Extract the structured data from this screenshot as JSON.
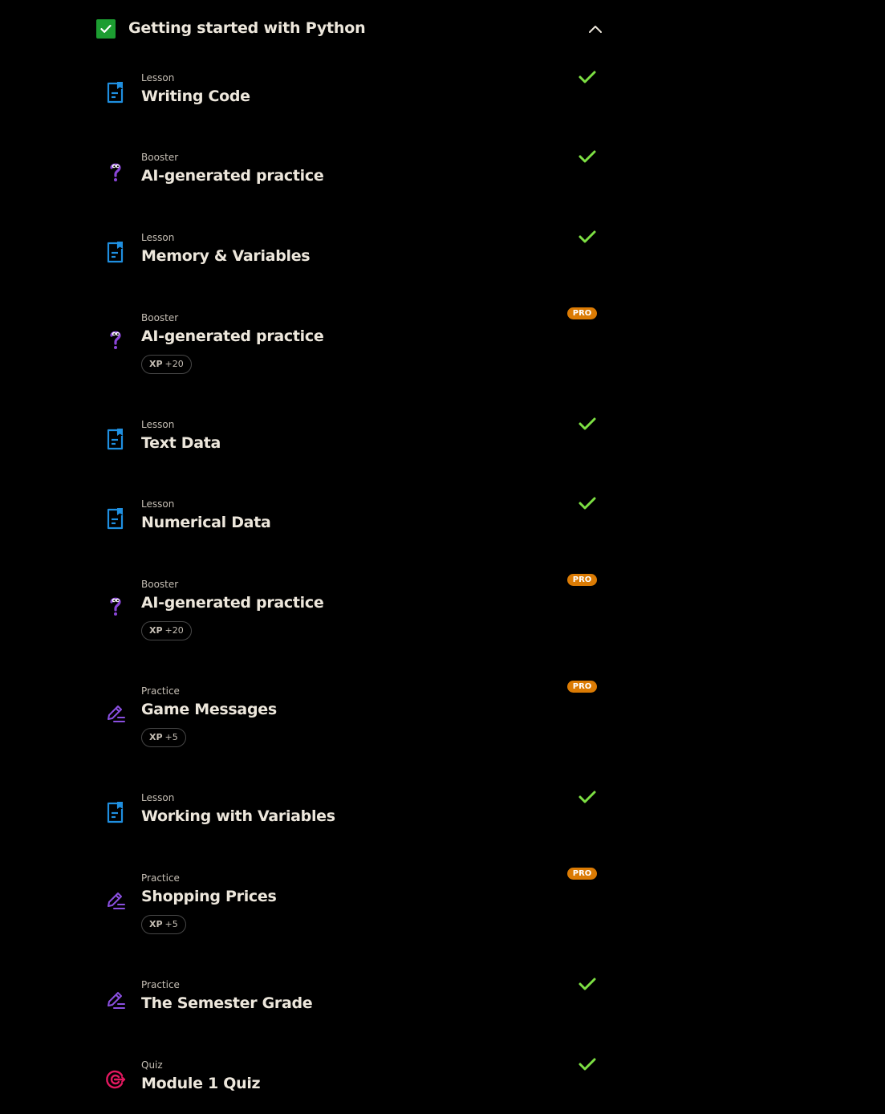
{
  "module": {
    "title": "Getting started with Python",
    "completed": true
  },
  "items": [
    {
      "type": "Lesson",
      "title": "Writing Code",
      "icon": "lesson-icon",
      "status": "completed"
    },
    {
      "type": "Booster",
      "title": "AI-generated practice",
      "icon": "booster-question-icon",
      "status": "completed"
    },
    {
      "type": "Lesson",
      "title": "Memory & Variables",
      "icon": "lesson-icon",
      "status": "completed"
    },
    {
      "type": "Booster",
      "title": "AI-generated practice",
      "icon": "booster-question-icon",
      "status": "pro",
      "pro_label": "PRO",
      "xp_label": "XP",
      "xp_value": "+20"
    },
    {
      "type": "Lesson",
      "title": "Text Data",
      "icon": "lesson-icon",
      "status": "completed"
    },
    {
      "type": "Lesson",
      "title": "Numerical Data",
      "icon": "lesson-icon",
      "status": "completed"
    },
    {
      "type": "Booster",
      "title": "AI-generated practice",
      "icon": "booster-question-icon",
      "status": "pro",
      "pro_label": "PRO",
      "xp_label": "XP",
      "xp_value": "+20"
    },
    {
      "type": "Practice",
      "title": "Game Messages",
      "icon": "practice-pencil-icon",
      "status": "pro",
      "pro_label": "PRO",
      "xp_label": "XP",
      "xp_value": "+5"
    },
    {
      "type": "Lesson",
      "title": "Working with Variables",
      "icon": "lesson-icon",
      "status": "completed"
    },
    {
      "type": "Practice",
      "title": "Shopping Prices",
      "icon": "practice-pencil-icon",
      "status": "pro",
      "pro_label": "PRO",
      "xp_label": "XP",
      "xp_value": "+5"
    },
    {
      "type": "Practice",
      "title": "The Semester Grade",
      "icon": "practice-pencil-icon",
      "status": "completed"
    },
    {
      "type": "Quiz",
      "title": "Module 1 Quiz",
      "icon": "quiz-target-icon",
      "status": "completed"
    }
  ],
  "colors": {
    "background": "#000000",
    "text": "#ede7dc",
    "muted_text": "#c6bfb5",
    "check_green": "#7de043",
    "module_check_bg": "#1c9d31",
    "pro_orange": "#db7b04",
    "lesson_blue": "#1f8fe0",
    "booster_purple": "#8a45d8",
    "practice_purple": "#8a4fe0",
    "quiz_pink": "#e2185f"
  }
}
